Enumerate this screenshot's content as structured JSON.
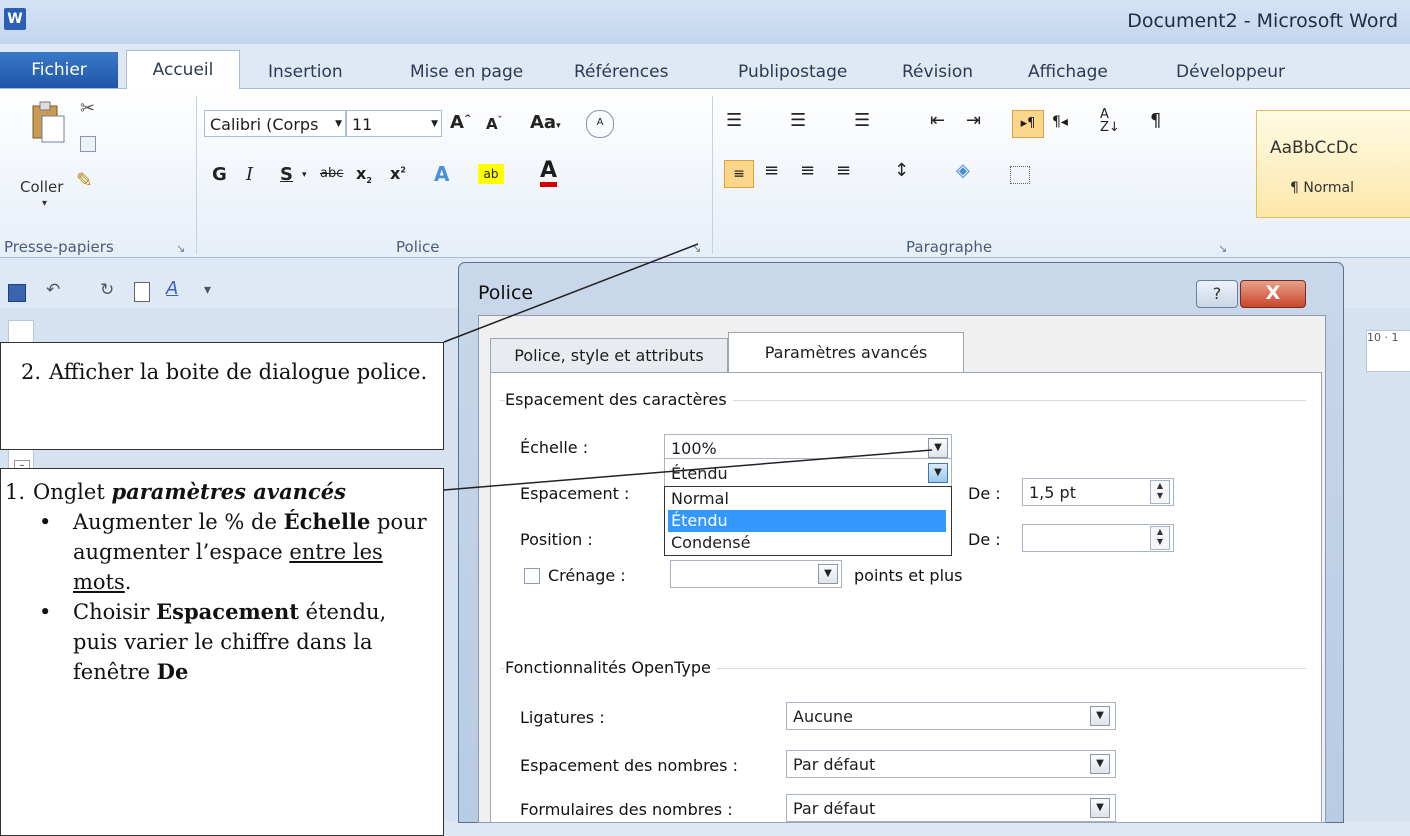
{
  "window": {
    "title": "Document2 - Microsoft Word",
    "logo_letter": "W"
  },
  "tabs": [
    "Fichier",
    "Accueil",
    "Insertion",
    "Mise en page",
    "Références",
    "Publipostage",
    "Révision",
    "Affichage",
    "Développeur"
  ],
  "ribbon": {
    "clipboard": {
      "paste_label": "Coller",
      "group_label": "Presse-papiers"
    },
    "font": {
      "font_name": "Calibri (Corps",
      "font_size": "11",
      "group_label": "Police",
      "bold": "G",
      "italic": "I",
      "underline": "S"
    },
    "paragraph": {
      "group_label": "Paragraphe"
    },
    "styles": {
      "sample": "AaBbCcDc",
      "name": "¶ Normal"
    }
  },
  "callouts": {
    "step2": {
      "number": "2.",
      "text": "Afficher la boite de dialogue police."
    },
    "step1": {
      "number": "1.",
      "text": "Onglet ",
      "emphasis": "paramètres avancés",
      "bullets": [
        {
          "t1": "Augmenter le % de ",
          "b1": "Échelle",
          "t2": " pour augmenter l’espace ",
          "u1": "entre les mots",
          "t3": "."
        },
        {
          "t1": "Choisir ",
          "b1": "Espacement",
          "t2": " étendu, puis varier le chiffre dans la fenêtre ",
          "b2": "De"
        }
      ]
    }
  },
  "dialog": {
    "title": "Police",
    "help_label": "?",
    "close_label": "X",
    "tabs": [
      "Police, style et attributs",
      "Paramètres avancés"
    ],
    "spacing_section": {
      "heading": "Espacement des caractères",
      "scale_label": "Échelle :",
      "scale_value": "100%",
      "spacing_label": "Espacement :",
      "spacing_value": "Étendu",
      "by_label": "De :",
      "by_value": "1,5 pt",
      "position_label": "Position :",
      "position_by_label": "De :",
      "position_by_value": "",
      "kerning_label": "Crénage :",
      "kerning_suffix": "points et plus",
      "spacing_options": [
        "Normal",
        "Étendu",
        "Condensé"
      ],
      "selected_option": "Étendu"
    },
    "opentype_section": {
      "heading": "Fonctionnalités OpenType",
      "ligatures_label": "Ligatures :",
      "ligatures_value": "Aucune",
      "number_spacing_label": "Espacement des nombres :",
      "number_spacing_value": "Par défaut",
      "number_forms_label": "Formulaires des nombres :",
      "number_forms_value": "Par défaut"
    }
  },
  "ruler_right": "10 · 1",
  "colors": {
    "selection": "#3399ff",
    "file_tab": "#2b63b8",
    "close_button": "#c8462a"
  }
}
